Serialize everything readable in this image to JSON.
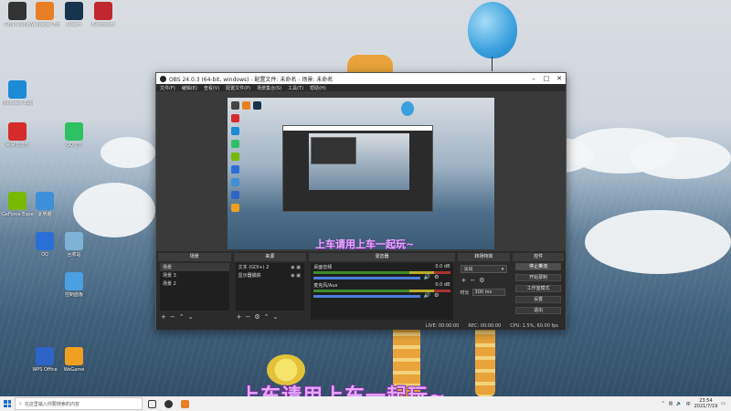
{
  "desktop": {
    "icons": [
      {
        "label": "OBS Studio",
        "color": "#333"
      },
      {
        "label": "Wallpaper Engine",
        "color": "#e87f24"
      },
      {
        "label": "Steam",
        "color": "#17344e"
      },
      {
        "label": "Bandicam",
        "color": "#c0282d"
      },
      {
        "label": "网易云音乐",
        "color": "#d62b2b"
      },
      {
        "label": "Microsoft Edge",
        "color": "#1c8ad4"
      },
      {
        "label": "QQ音乐",
        "color": "#2ec162"
      },
      {
        "label": "GeForce Experience",
        "color": "#76b900"
      },
      {
        "label": "QQ",
        "color": "#2a6fd6"
      },
      {
        "label": "回收站",
        "color": "#7fb3d5"
      },
      {
        "label": "此电脑",
        "color": "#3c8fd8"
      },
      {
        "label": "控制面板",
        "color": "#4aa0e0"
      },
      {
        "label": "WPS Office",
        "color": "#2d64c8"
      },
      {
        "label": "WeGame",
        "color": "#f0a020"
      }
    ]
  },
  "caption": "上车请用上车一起玩~",
  "obs": {
    "title": "OBS 24.0.3 (64-bit, windows) - 配置文件: 未命名 - 场景: 未命名",
    "menu": [
      "文件(F)",
      "编辑(E)",
      "查看(V)",
      "配置文件(P)",
      "场景集合(S)",
      "工具(T)",
      "帮助(H)"
    ],
    "preview_caption": "上车请用上车一起玩~",
    "docks": {
      "scenes": {
        "title": "场景",
        "items": [
          "场景",
          "场景 3",
          "场景 2"
        ]
      },
      "sources": {
        "title": "来源",
        "items": [
          "文本 (GDI+) 2",
          "显示器捕获"
        ]
      },
      "mixer": {
        "title": "混音器",
        "tracks": [
          {
            "name": "桌面音频",
            "db": "0.0 dB"
          },
          {
            "name": "麦克风/Aux",
            "db": "0.0 dB"
          }
        ]
      },
      "transitions": {
        "title": "转场特效",
        "selected": "淡出",
        "duration_label": "时长",
        "duration": "300 ms"
      },
      "controls": {
        "title": "控件",
        "buttons": [
          "停止推流",
          "开始录制",
          "工作室模式",
          "设置",
          "退出"
        ]
      }
    },
    "status": {
      "live": "LIVE: 00:00:00",
      "rec": "REC: 00:00:00",
      "cpu": "CPU: 1.5%, 60.00 fps"
    }
  },
  "taskbar": {
    "search_placeholder": "在这里输入你要搜索的内容",
    "time": "23:54",
    "date": "2021/7/19"
  },
  "colors": {
    "accent": "#4d7de0",
    "caption": "#e8a8ff"
  }
}
